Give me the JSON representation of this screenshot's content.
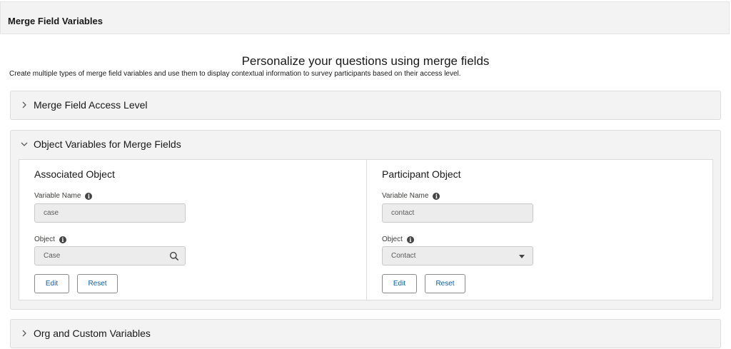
{
  "header": {
    "title": "Merge Field Variables"
  },
  "intro": {
    "heading": "Personalize your questions using merge fields",
    "description": "Create multiple types of merge field variables and use them to display contextual information to survey participants based on their access level."
  },
  "sections": {
    "access_level": {
      "label": "Merge Field Access Level",
      "expanded": false
    },
    "object_variables": {
      "label": "Object Variables for Merge Fields",
      "expanded": true,
      "associated": {
        "title": "Associated Object",
        "variable_name_label": "Variable Name",
        "variable_name_value": "case",
        "object_label": "Object",
        "object_value": "Case",
        "object_icon": "search-icon",
        "edit_label": "Edit",
        "reset_label": "Reset"
      },
      "participant": {
        "title": "Participant Object",
        "variable_name_label": "Variable Name",
        "variable_name_value": "contact",
        "object_label": "Object",
        "object_value": "Contact",
        "object_icon": "caret-down-icon",
        "edit_label": "Edit",
        "reset_label": "Reset"
      }
    },
    "org_custom": {
      "label": "Org and Custom Variables",
      "expanded": false
    }
  },
  "colors": {
    "link_blue": "#0b5cab",
    "header_bg": "#f3f3f3",
    "field_bg": "#ececec"
  }
}
